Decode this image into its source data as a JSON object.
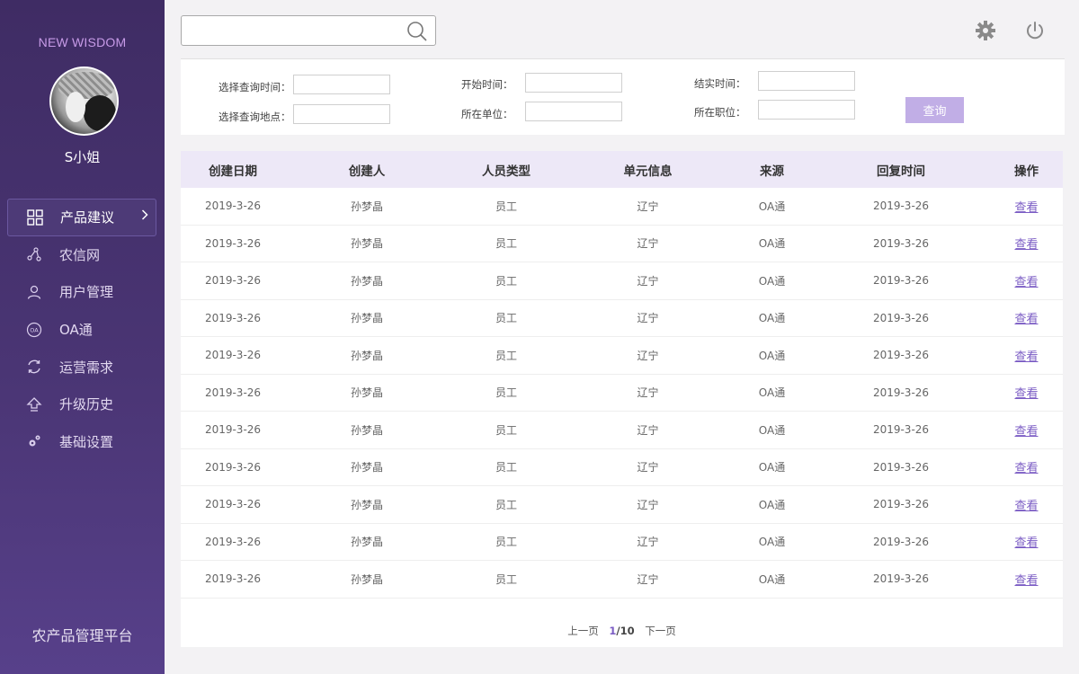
{
  "sidebar": {
    "brand": "NEW WISDOM",
    "username": "S小姐",
    "items": [
      {
        "label": "产品建议",
        "icon": "grid-icon"
      },
      {
        "label": "农信网",
        "icon": "network-icon"
      },
      {
        "label": "用户管理",
        "icon": "user-icon"
      },
      {
        "label": "OA通",
        "icon": "oa-icon"
      },
      {
        "label": "运营需求",
        "icon": "refresh-icon"
      },
      {
        "label": "升级历史",
        "icon": "upload-icon"
      },
      {
        "label": "基础设置",
        "icon": "gears-icon"
      }
    ],
    "footer": "农产品管理平台"
  },
  "search": {
    "placeholder": ""
  },
  "filters": {
    "query_time_label": "选择查询时间：",
    "query_place_label": "选择查询地点：",
    "start_time_label": "开始时间：",
    "unit_label": "所在单位：",
    "end_time_label": "结实时间：",
    "position_label": "所在职位：",
    "query_button": "查询"
  },
  "table": {
    "headers": [
      "创建日期",
      "创建人",
      "人员类型",
      "单元信息",
      "来源",
      "回复时间",
      "操作"
    ],
    "rows": [
      [
        "2019-3-26",
        "孙梦晶",
        "员工",
        "辽宁",
        "OA通",
        "2019-3-26",
        "查看"
      ],
      [
        "2019-3-26",
        "孙梦晶",
        "员工",
        "辽宁",
        "OA通",
        "2019-3-26",
        "查看"
      ],
      [
        "2019-3-26",
        "孙梦晶",
        "员工",
        "辽宁",
        "OA通",
        "2019-3-26",
        "查看"
      ],
      [
        "2019-3-26",
        "孙梦晶",
        "员工",
        "辽宁",
        "OA通",
        "2019-3-26",
        "查看"
      ],
      [
        "2019-3-26",
        "孙梦晶",
        "员工",
        "辽宁",
        "OA通",
        "2019-3-26",
        "查看"
      ],
      [
        "2019-3-26",
        "孙梦晶",
        "员工",
        "辽宁",
        "OA通",
        "2019-3-26",
        "查看"
      ],
      [
        "2019-3-26",
        "孙梦晶",
        "员工",
        "辽宁",
        "OA通",
        "2019-3-26",
        "查看"
      ],
      [
        "2019-3-26",
        "孙梦晶",
        "员工",
        "辽宁",
        "OA通",
        "2019-3-26",
        "查看"
      ],
      [
        "2019-3-26",
        "孙梦晶",
        "员工",
        "辽宁",
        "OA通",
        "2019-3-26",
        "查看"
      ],
      [
        "2019-3-26",
        "孙梦晶",
        "员工",
        "辽宁",
        "OA通",
        "2019-3-26",
        "查看"
      ],
      [
        "2019-3-26",
        "孙梦晶",
        "员工",
        "辽宁",
        "OA通",
        "2019-3-26",
        "查看"
      ]
    ]
  },
  "pager": {
    "prev": "上一页",
    "current": "1",
    "total": "/10",
    "next": "下一页"
  },
  "colors": {
    "accent": "#7b5cc4",
    "sidebar": "#45306b",
    "header_bg": "#ede8f7",
    "button": "#c1aee6"
  }
}
